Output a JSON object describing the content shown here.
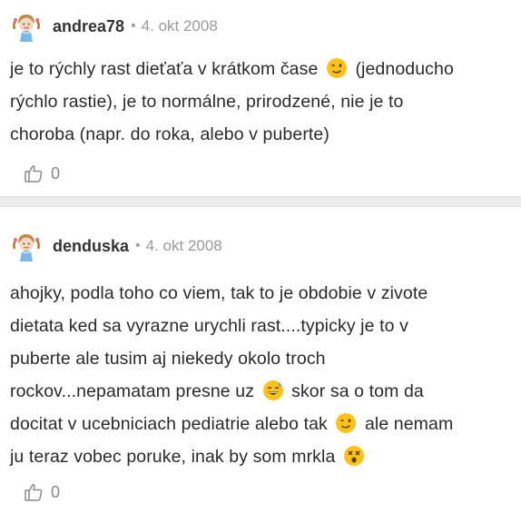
{
  "comments": [
    {
      "author": "andrea78",
      "separator": "•",
      "date": "4. okt 2008",
      "lines": [
        [
          "je to rýchly rast dieťaťa v krátkom čase ",
          "wink-emoji",
          " (jednoducho"
        ],
        [
          "rýchlo rastie), je to normálne, prirodzené, nie je to"
        ],
        [
          "choroba (napr. do roka, alebo v puberte)"
        ]
      ],
      "likes": "0"
    },
    {
      "author": "denduska",
      "separator": "•",
      "date": "4. okt 2008",
      "lines": [
        [
          "ahojky, podla toho co viem, tak to je obdobie v zivote"
        ],
        [
          "dietata ked sa vyrazne urychli rast....typicky je to v"
        ],
        [
          "puberte ale tusim aj niekedy okolo troch"
        ],
        [
          "rockov...nepamatam presne uz ",
          "sweat-smile-emoji",
          " skor sa o tom da"
        ],
        [
          "docitat v ucebniciach pediatrie alebo tak ",
          "wink-emoji",
          " ale nemam"
        ],
        [
          "ju teraz vobec poruke, inak by som mrkla ",
          "dizzy-face-emoji",
          ""
        ]
      ],
      "likes": "0"
    }
  ],
  "icons": {
    "avatar": "girl-avatar-icon",
    "like": "thumbs-up-icon"
  }
}
